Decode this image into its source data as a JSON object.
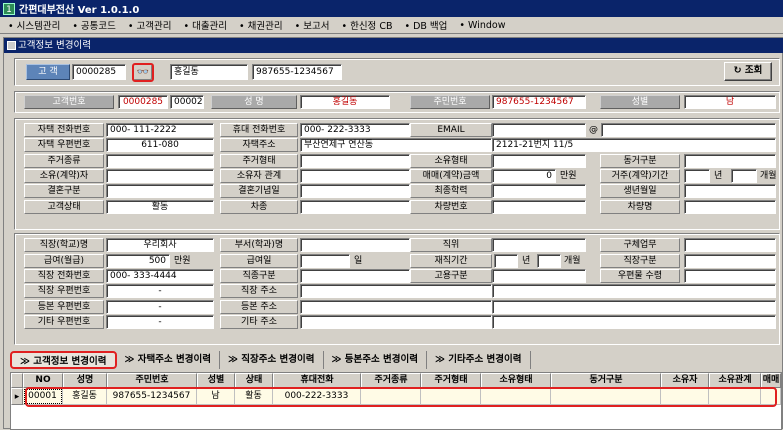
{
  "app": {
    "title": "간편대부전산 Ver 1.0.1.0",
    "icon": "1"
  },
  "menu": [
    "시스템관리",
    "공통코드",
    "고객관리",
    "대출관리",
    "채권관리",
    "보고서",
    "한신정 CB",
    "DB 백업",
    "Window"
  ],
  "window": {
    "title": "고객정보 변경이력"
  },
  "search": {
    "label": "고 객",
    "customer_no": "0000285",
    "name": "홍길동",
    "resident_no": "987655-1234567",
    "query_button": "조회"
  },
  "summary": {
    "labels": {
      "customer_no": "고객번호",
      "name": "성 명",
      "resident_no": "주민번호",
      "gender": "성별"
    },
    "customer_no": "0000285",
    "sub_no": "00002",
    "name": "홍길동",
    "resident_no": "987655-1234567",
    "gender": "남"
  },
  "personal": {
    "labels": {
      "home_phone": "자택 전화번호",
      "mobile": "휴대 전화번호",
      "email": "EMAIL",
      "home_zip": "자택 우편번호",
      "home_addr": "자택주소",
      "residence_type": "주거종류",
      "residence_form": "주거형태",
      "ownership_form": "소유형태",
      "cohabit": "동거구분",
      "owner": "소유(계약)자",
      "owner_relation": "소유자 관계",
      "trade_amount": "매매(계약)금액",
      "residence_period": "거주(계약)기간",
      "marital": "결혼구분",
      "anniversary": "결혼기념일",
      "education": "최종학력",
      "birthday": "생년월일",
      "status": "고객상태",
      "car_type": "차종",
      "car_no": "차량번호",
      "car_name": "차량명"
    },
    "home_phone": "000- 111-2222",
    "mobile": "000- 222-3333",
    "home_zip": "611-080",
    "home_addr1": "부산연제구 연산동",
    "home_addr2": "2121-21번지 11/5",
    "email_at": "@",
    "trade_amount": "0",
    "unit_manwon": "만원",
    "unit_year": "년",
    "unit_month": "개월",
    "status": "활동"
  },
  "work": {
    "labels": {
      "company": "직장(학교)명",
      "dept": "부서(학과)명",
      "position": "직위",
      "duty": "구체업무",
      "salary": "급여(월급)",
      "payday": "급여일",
      "tenure": "재직기간",
      "job_type": "직장구분",
      "work_phone": "직장 전화번호",
      "job_kind": "직종구분",
      "employ_type": "고용구분",
      "mail_receive": "우편물 수령",
      "work_zip": "직장 우편번호",
      "work_addr": "직장 주소",
      "reg_zip": "등본 우편번호",
      "reg_addr": "등본 주소",
      "etc_zip": "기타 우편번호",
      "etc_addr": "기타 주소"
    },
    "company": "우리회사",
    "salary": "500",
    "unit_manwon": "만원",
    "unit_day": "일",
    "unit_year": "년",
    "unit_month": "개월",
    "work_phone": "000- 333-4444",
    "work_zip": "-",
    "reg_zip": "-",
    "etc_zip": "-"
  },
  "tabs": [
    "고객정보 변경이력",
    "자택주소 변경이력",
    "직장주소 변경이력",
    "등본주소 변경이력",
    "기타주소 변경이력"
  ],
  "grid": {
    "headers": [
      "NO",
      "성명",
      "주민번호",
      "성별",
      "상태",
      "휴대전화",
      "주거종류",
      "주거형태",
      "소유형태",
      "동거구분",
      "소유자",
      "소유관계",
      "매매"
    ],
    "rows": [
      [
        "00001",
        "홍길동",
        "987655-1234567",
        "남",
        "활동",
        "000-222-3333",
        "",
        "",
        "",
        "",
        "",
        "",
        ""
      ]
    ]
  },
  "colors": {
    "title_bg": "#0a246a",
    "label_blue": "#5d84b8",
    "highlight_red": "#e02020"
  }
}
